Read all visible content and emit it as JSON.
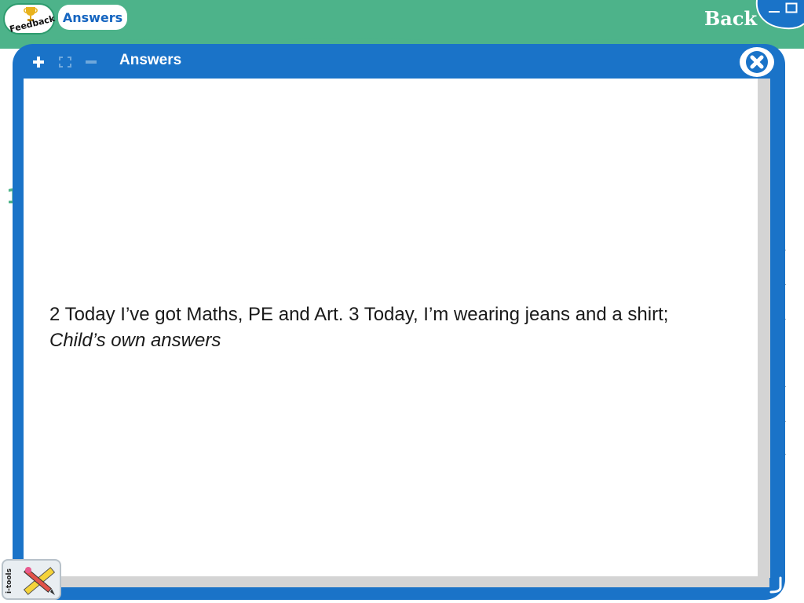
{
  "header": {
    "feedback_label": "Feedback",
    "answers_tab_label": "Answers",
    "back_label": "Back"
  },
  "dialog": {
    "title": "Answers",
    "answer_line_1": "2 Today I’ve got Maths, PE and Art. 3 Today, I’m wearing jeans and a shirt;",
    "answer_line_2": "Child’s own answers"
  },
  "background": {
    "partial_digit": "1"
  },
  "tools": {
    "itools_label": "i-tools"
  },
  "colors": {
    "banner_green": "#4db38a",
    "dialog_blue": "#1a73c8",
    "tab_text_blue": "#1565c0"
  },
  "icons": [
    "trophy-icon",
    "plus-icon",
    "fullscreen-icon",
    "minus-icon",
    "close-icon",
    "minimize-icon",
    "restore-icon",
    "pencil-ruler-icon",
    "resize-grip-icon"
  ]
}
